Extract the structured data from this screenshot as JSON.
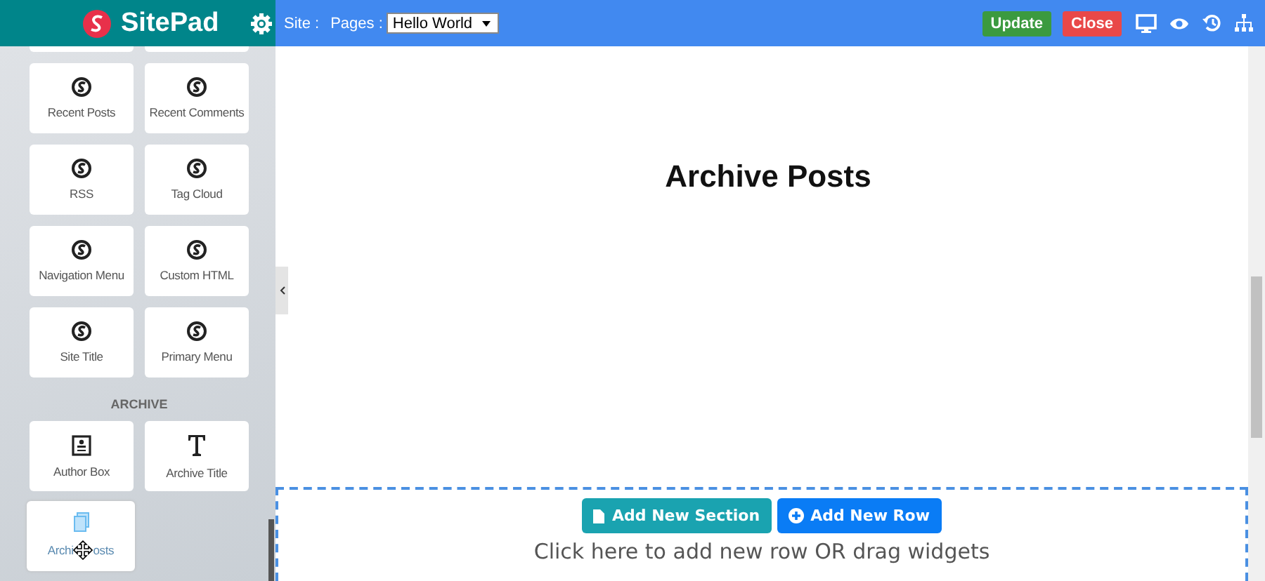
{
  "brand": {
    "name": "SitePad"
  },
  "topbar": {
    "site_label": "Site :",
    "pages_label": "Pages :",
    "page_select": "Hello World",
    "buttons": [
      {
        "label": "Update",
        "kind": "update"
      },
      {
        "label": "Close",
        "kind": "close"
      }
    ]
  },
  "widgets": [
    {
      "label": "Recent Posts",
      "kind": "logo"
    },
    {
      "label": "Recent Comments",
      "kind": "logo"
    },
    {
      "label": "RSS",
      "kind": "logo"
    },
    {
      "label": "Tag Cloud",
      "kind": "logo"
    },
    {
      "label": "Navigation Menu",
      "kind": "logo"
    },
    {
      "label": "Custom HTML",
      "kind": "logo"
    },
    {
      "label": "Site Title",
      "kind": "logo"
    },
    {
      "label": "Primary Menu",
      "kind": "logo"
    }
  ],
  "archive": {
    "heading": "ARCHIVE",
    "widgets": [
      {
        "label": "Author Box",
        "kind": "author"
      },
      {
        "label": "Archive Title",
        "kind": "title"
      }
    ],
    "dragging": {
      "label_start": "Archi",
      "label_end": "osts"
    }
  },
  "canvas": {
    "title": "Archive Posts",
    "buttons": [
      {
        "label": "Add New Section",
        "kind": "section"
      },
      {
        "label": "Add New Row",
        "kind": "row"
      }
    ],
    "hint": "Click here to add new row OR drag widgets"
  }
}
